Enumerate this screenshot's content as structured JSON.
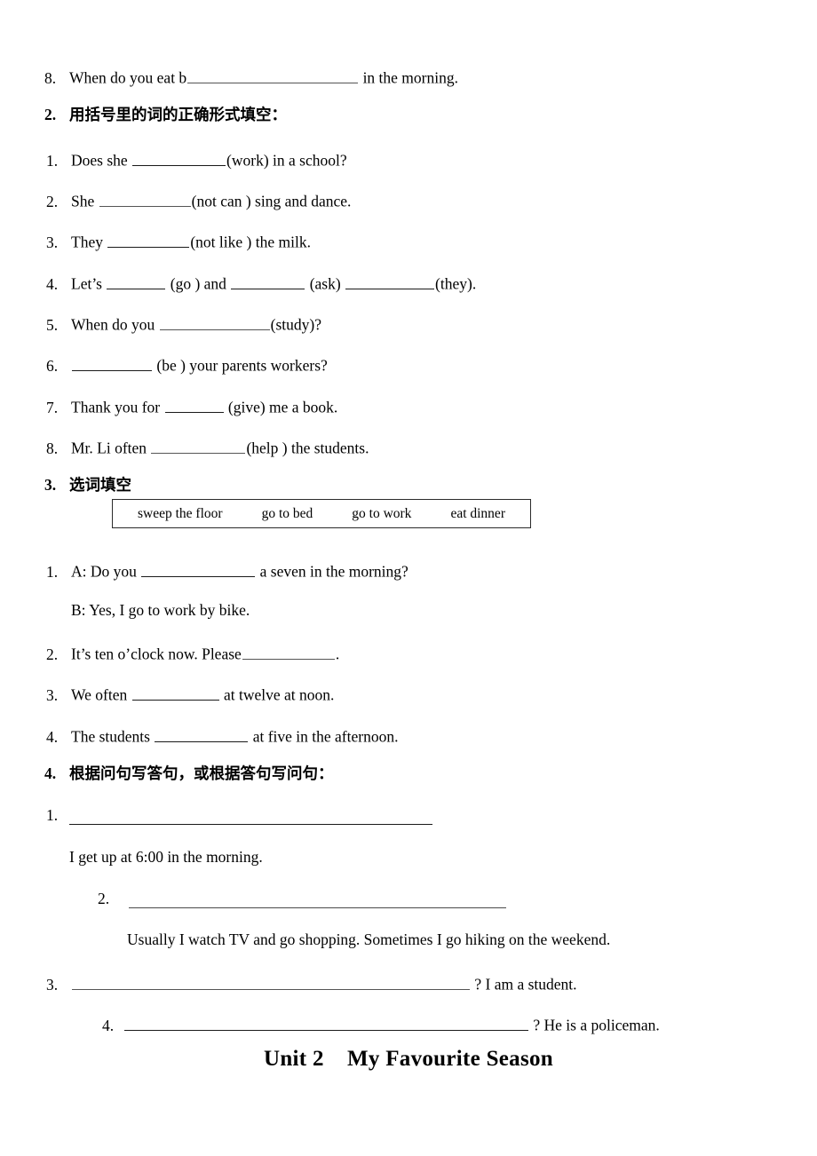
{
  "document": {
    "type": "worksheet-page",
    "language": "zh-CN + en",
    "unit_title": "Unit 2    My Favourite Season"
  },
  "carryover_item": {
    "number": "8.",
    "text_before": "When do you eat b",
    "text_after": "in the morning."
  },
  "section2": {
    "number": "2.",
    "title": "用括号里的词的正确形式填空：",
    "items": [
      {
        "number": "1.",
        "before": "Does she",
        "after": "(work) in a school?"
      },
      {
        "number": "2.",
        "before": "She",
        "after": "(not    can ) sing and dance."
      },
      {
        "number": "3.",
        "before": "They",
        "after": "(not like ) the milk."
      },
      {
        "number": "4.",
        "before": "Let’s",
        "mid1": "(go ) and",
        "mid2": "(ask)",
        "after": "(they)."
      },
      {
        "number": "5.",
        "before": "When do you",
        "after": "(study)?"
      },
      {
        "number": "6.",
        "before": "",
        "after": "(be ) your parents workers?"
      },
      {
        "number": "7.",
        "before": "Thank you for",
        "after": "(give) me a book."
      },
      {
        "number": "8.",
        "before": "Mr. Li often",
        "after": "(help ) the students."
      }
    ]
  },
  "section3": {
    "number": "3.",
    "title": "选词填空",
    "word_bank": [
      "sweep the floor",
      "go to bed",
      "go to work",
      "eat dinner"
    ],
    "items": [
      {
        "number": "1.",
        "before": "A: Do you",
        "after": "a seven in the morning?",
        "follow_up": "B: Yes, I go to work by bike."
      },
      {
        "number": "2.",
        "before": "It’s ten o’clock now. Please",
        "after": "."
      },
      {
        "number": "3.",
        "before": "We often",
        "after": "at twelve at noon."
      },
      {
        "number": "4.",
        "before": "The students",
        "after": "at five in the afternoon."
      }
    ]
  },
  "section4": {
    "number": "4.",
    "title": "根据问句写答句，或根据答句写问句：",
    "items": [
      {
        "number": "1.",
        "answer": "I get up at 6:00 in the morning."
      },
      {
        "number": "2.",
        "answer": "Usually I watch TV and go shopping. Sometimes I go hiking on the weekend."
      },
      {
        "number": "3.",
        "answer": "? I am a student."
      },
      {
        "number": "4.",
        "answer": "? He is a policeman."
      }
    ]
  }
}
